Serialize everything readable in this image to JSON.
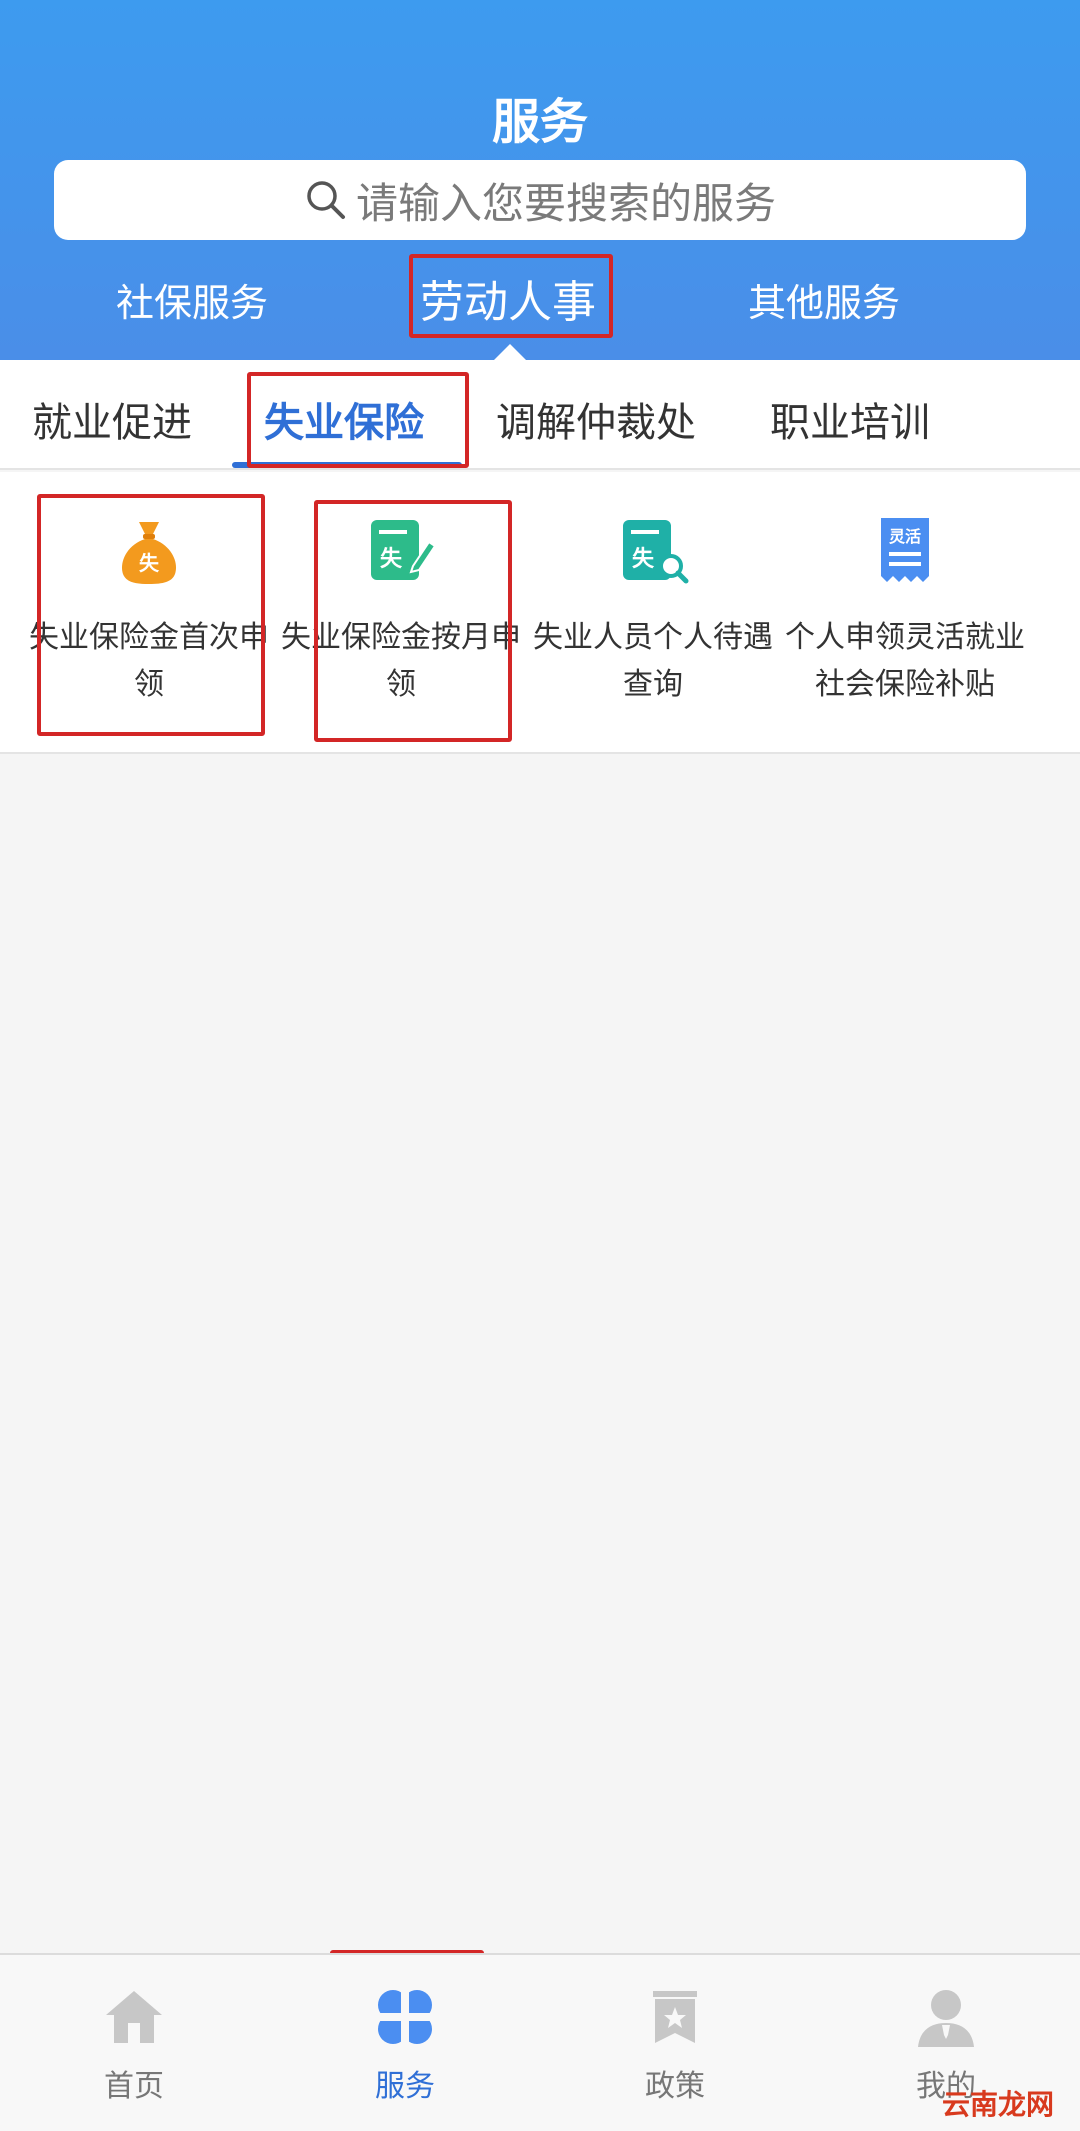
{
  "header": {
    "title": "服务",
    "search_placeholder": "请输入您要搜索的服务",
    "tabs": [
      {
        "label": "社保服务"
      },
      {
        "label": "劳动人事"
      },
      {
        "label": "其他服务"
      }
    ]
  },
  "subtabs": [
    {
      "label": "就业促进"
    },
    {
      "label": "失业保险"
    },
    {
      "label": "调解仲裁处"
    },
    {
      "label": "职业培训"
    }
  ],
  "services": [
    {
      "label": "失业保险金首次申领",
      "icon": "money-bag-icon",
      "icon_text": "失"
    },
    {
      "label": "失业保险金按月申领",
      "icon": "form-edit-icon",
      "icon_text": "失"
    },
    {
      "label": "失业人员个人待遇查询",
      "icon": "form-search-icon",
      "icon_text": "失"
    },
    {
      "label": "个人申领灵活就业社会保险补贴",
      "icon": "receipt-icon",
      "icon_text": "灵活"
    }
  ],
  "bottom_nav": [
    {
      "label": "首页",
      "icon": "home-icon"
    },
    {
      "label": "服务",
      "icon": "services-icon"
    },
    {
      "label": "政策",
      "icon": "policy-icon"
    },
    {
      "label": "我的",
      "icon": "profile-icon"
    }
  ],
  "watermark": "云南龙网",
  "colors": {
    "header_blue": "#3d9bef",
    "accent_blue": "#2f6fd6",
    "highlight_red": "#d32626",
    "orange": "#f39a1e",
    "green": "#2dbb8a",
    "teal": "#1fb0a7",
    "icon_blue": "#4b8ef1"
  }
}
